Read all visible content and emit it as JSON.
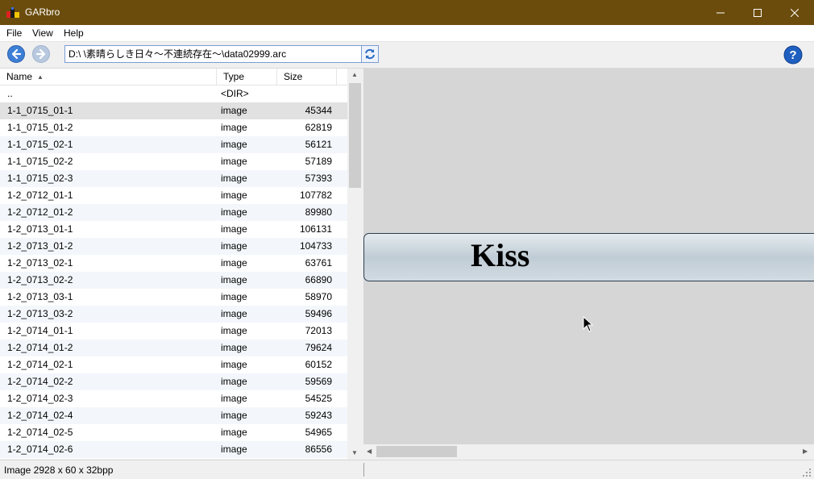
{
  "window": {
    "title": "GARbro",
    "minimize": "—",
    "maximize": "☐",
    "close": "✕"
  },
  "menu": {
    "items": [
      "File",
      "View",
      "Help"
    ]
  },
  "toolbar": {
    "path_value": "D:\\     \\素晴らしき日々～不連続存在～\\data02999.arc",
    "help_label": "?"
  },
  "list": {
    "columns": {
      "name": "Name",
      "type": "Type",
      "size": "Size"
    },
    "rows": [
      {
        "name": "..",
        "type": "<DIR>",
        "size": ""
      },
      {
        "name": "1-1_0715_01-1",
        "type": "image",
        "size": "45344"
      },
      {
        "name": "1-1_0715_01-2",
        "type": "image",
        "size": "62819"
      },
      {
        "name": "1-1_0715_02-1",
        "type": "image",
        "size": "56121"
      },
      {
        "name": "1-1_0715_02-2",
        "type": "image",
        "size": "57189"
      },
      {
        "name": "1-1_0715_02-3",
        "type": "image",
        "size": "57393"
      },
      {
        "name": "1-2_0712_01-1",
        "type": "image",
        "size": "107782"
      },
      {
        "name": "1-2_0712_01-2",
        "type": "image",
        "size": "89980"
      },
      {
        "name": "1-2_0713_01-1",
        "type": "image",
        "size": "106131"
      },
      {
        "name": "1-2_0713_01-2",
        "type": "image",
        "size": "104733"
      },
      {
        "name": "1-2_0713_02-1",
        "type": "image",
        "size": "63761"
      },
      {
        "name": "1-2_0713_02-2",
        "type": "image",
        "size": "66890"
      },
      {
        "name": "1-2_0713_03-1",
        "type": "image",
        "size": "58970"
      },
      {
        "name": "1-2_0713_03-2",
        "type": "image",
        "size": "59496"
      },
      {
        "name": "1-2_0714_01-1",
        "type": "image",
        "size": "72013"
      },
      {
        "name": "1-2_0714_01-2",
        "type": "image",
        "size": "79624"
      },
      {
        "name": "1-2_0714_02-1",
        "type": "image",
        "size": "60152"
      },
      {
        "name": "1-2_0714_02-2",
        "type": "image",
        "size": "59569"
      },
      {
        "name": "1-2_0714_02-3",
        "type": "image",
        "size": "54525"
      },
      {
        "name": "1-2_0714_02-4",
        "type": "image",
        "size": "59243"
      },
      {
        "name": "1-2_0714_02-5",
        "type": "image",
        "size": "54965"
      },
      {
        "name": "1-2_0714_02-6",
        "type": "image",
        "size": "86556"
      }
    ],
    "selected_index": 1
  },
  "preview": {
    "text": "Kiss"
  },
  "status": {
    "text": "Image 2928 x 60 x 32bpp"
  },
  "colors": {
    "titlebar": "#6b4c0c",
    "preview_bg": "#d6d6d6",
    "selection": "#e1e1e1"
  }
}
